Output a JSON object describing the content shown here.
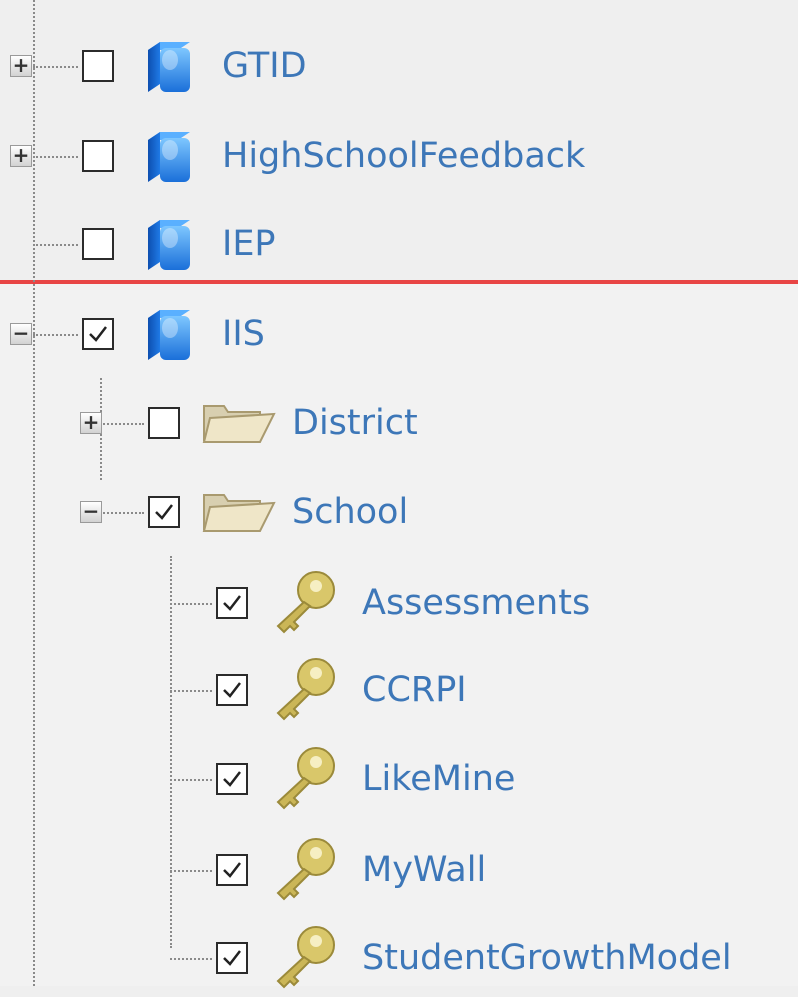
{
  "tree": {
    "nodes": [
      {
        "label": "GTID",
        "icon": "cube-icon",
        "expander": "plus",
        "checked": false
      },
      {
        "label": "HighSchoolFeedback",
        "icon": "cube-icon",
        "expander": "plus",
        "checked": false
      },
      {
        "label": "IEP",
        "icon": "cube-icon",
        "expander": "none",
        "checked": false
      },
      {
        "label": "IIS",
        "icon": "cube-icon",
        "expander": "minus",
        "checked": true
      },
      {
        "label": "District",
        "icon": "folder-icon",
        "expander": "plus",
        "checked": false
      },
      {
        "label": "School",
        "icon": "folder-icon",
        "expander": "minus",
        "checked": true
      },
      {
        "label": "Assessments",
        "icon": "key-icon",
        "expander": "none",
        "checked": true
      },
      {
        "label": "CCRPI",
        "icon": "key-icon",
        "expander": "none",
        "checked": true
      },
      {
        "label": "LikeMine",
        "icon": "key-icon",
        "expander": "none",
        "checked": true
      },
      {
        "label": "MyWall",
        "icon": "key-icon",
        "expander": "none",
        "checked": true
      },
      {
        "label": "StudentGrowthModel",
        "icon": "key-icon",
        "expander": "none",
        "checked": true
      }
    ]
  },
  "colors": {
    "label": "#3d77b8",
    "highlight_line": "#e84545",
    "background": "#efefef"
  }
}
